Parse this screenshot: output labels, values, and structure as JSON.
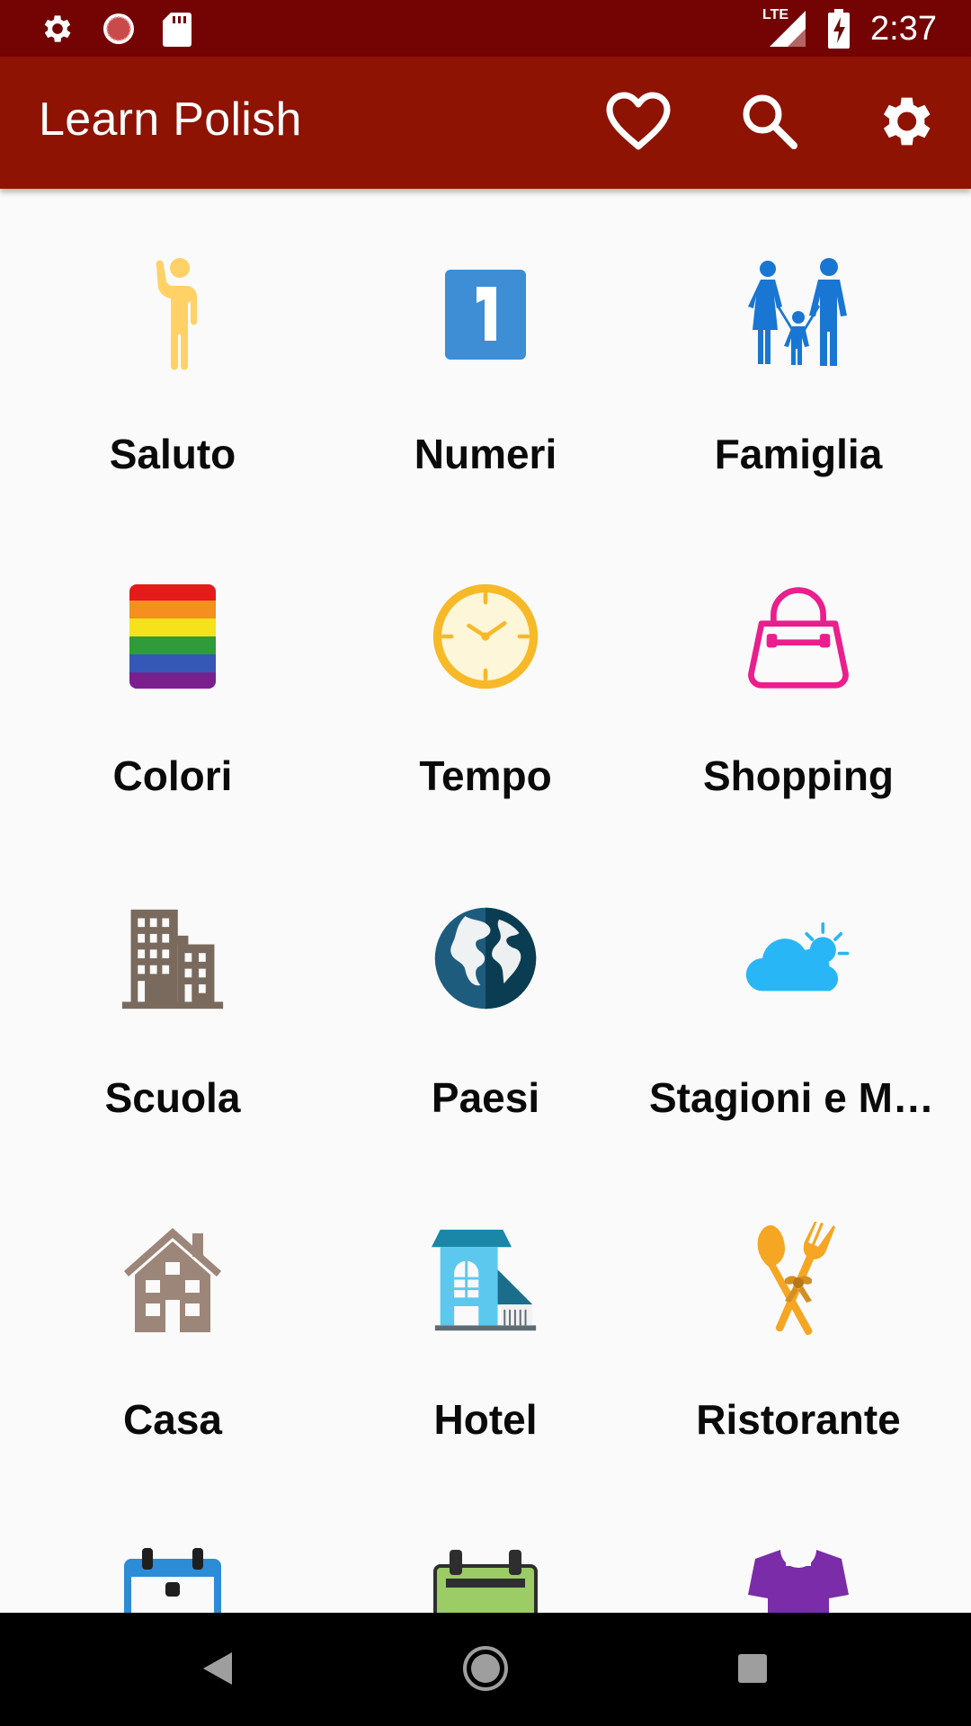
{
  "status_bar": {
    "time": "2:37",
    "network_label": "LTE",
    "icons": [
      "settings-notification-icon",
      "record-notification-icon",
      "sd-card-icon",
      "signal-icon",
      "battery-charging-icon"
    ]
  },
  "app_bar": {
    "title": "Learn Polish",
    "actions": [
      "heart-icon",
      "search-icon",
      "settings-icon"
    ],
    "background_color": "#8E1302"
  },
  "categories": [
    {
      "label": "Saluto",
      "icon": "waving-person-icon"
    },
    {
      "label": "Numeri",
      "icon": "number-one-icon"
    },
    {
      "label": "Famiglia",
      "icon": "family-icon"
    },
    {
      "label": "Colori",
      "icon": "color-palette-icon"
    },
    {
      "label": "Tempo",
      "icon": "clock-icon"
    },
    {
      "label": "Shopping",
      "icon": "shopping-bag-icon"
    },
    {
      "label": "Scuola",
      "icon": "buildings-icon"
    },
    {
      "label": "Paesi",
      "icon": "globe-icon"
    },
    {
      "label": "Stagioni e Meteo",
      "icon": "weather-icon"
    },
    {
      "label": "Casa",
      "icon": "house-icon"
    },
    {
      "label": "Hotel",
      "icon": "hotel-icon"
    },
    {
      "label": "Ristorante",
      "icon": "cutlery-icon"
    },
    {
      "label": "",
      "icon": "calendar-icon"
    },
    {
      "label": "",
      "icon": "board-icon"
    },
    {
      "label": "",
      "icon": "clothing-icon"
    }
  ],
  "nav_bar": {
    "buttons": [
      "back-icon",
      "home-icon",
      "recents-icon"
    ]
  }
}
